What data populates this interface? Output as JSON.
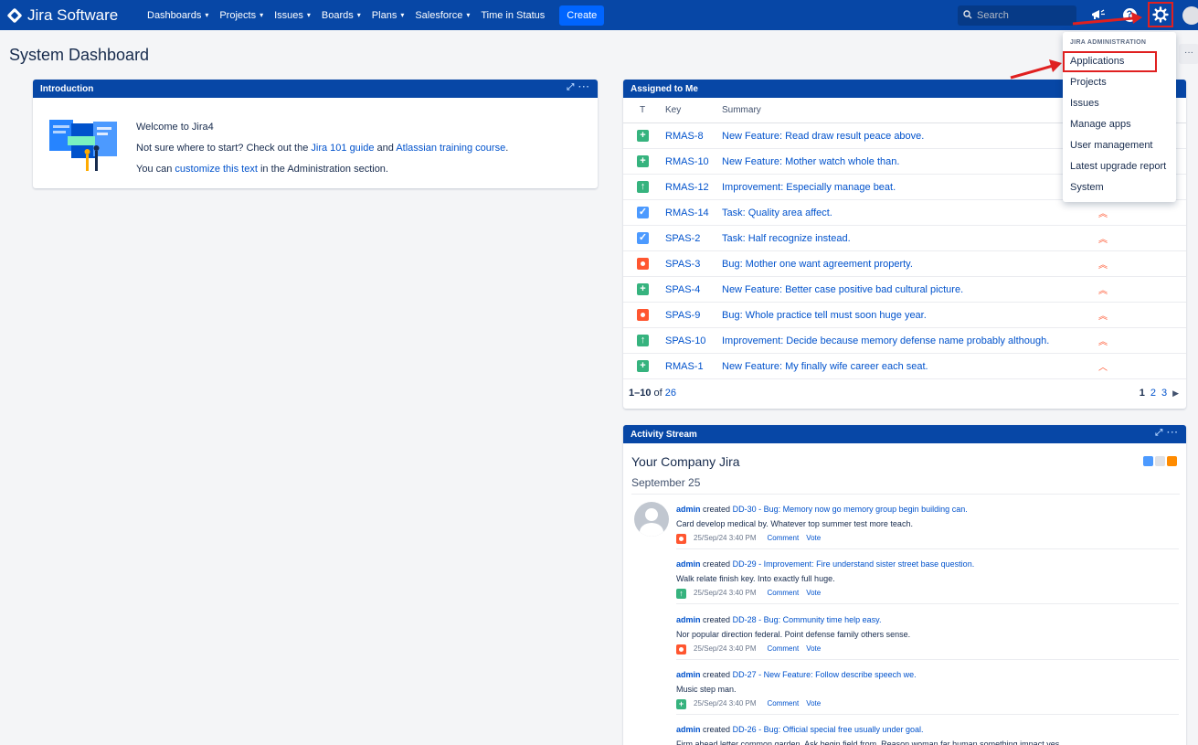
{
  "topnav": {
    "brand": "Jira Software",
    "items": [
      {
        "label": "Dashboards",
        "dropdown": true
      },
      {
        "label": "Projects",
        "dropdown": true
      },
      {
        "label": "Issues",
        "dropdown": true
      },
      {
        "label": "Boards",
        "dropdown": true
      },
      {
        "label": "Plans",
        "dropdown": true
      },
      {
        "label": "Salesforce",
        "dropdown": true
      },
      {
        "label": "Time in Status",
        "dropdown": false
      }
    ],
    "create_label": "Create",
    "search_placeholder": "Search"
  },
  "page": {
    "title": "System Dashboard",
    "more_label": "···"
  },
  "introduction": {
    "title": "Introduction",
    "welcome": "Welcome to Jira4",
    "line2_pre": "Not sure where to start? Check out the ",
    "line2_link1": "Jira 101 guide",
    "line2_mid": " and ",
    "line2_link2": "Atlassian training course",
    "line2_post": ".",
    "line3_pre": "You can ",
    "line3_link": "customize this text",
    "line3_post": " in the Administration section."
  },
  "assigned": {
    "title": "Assigned to Me",
    "headers": {
      "type": "T",
      "key": "Key",
      "summary": "Summary"
    },
    "rows": [
      {
        "type": "feature",
        "key": "RMAS-8",
        "summary": "New Feature: Read draw result peace above.",
        "priority": "highest"
      },
      {
        "type": "feature",
        "key": "RMAS-10",
        "summary": "New Feature: Mother watch whole than.",
        "priority": "highest"
      },
      {
        "type": "improvement",
        "key": "RMAS-12",
        "summary": "Improvement: Especially manage beat.",
        "priority": "highest"
      },
      {
        "type": "task",
        "key": "RMAS-14",
        "summary": "Task: Quality area affect.",
        "priority": "highest"
      },
      {
        "type": "task",
        "key": "SPAS-2",
        "summary": "Task: Half recognize instead.",
        "priority": "highest"
      },
      {
        "type": "bug",
        "key": "SPAS-3",
        "summary": "Bug: Mother one want agreement property.",
        "priority": "highest"
      },
      {
        "type": "feature",
        "key": "SPAS-4",
        "summary": "New Feature: Better case positive bad cultural picture.",
        "priority": "highest"
      },
      {
        "type": "bug",
        "key": "SPAS-9",
        "summary": "Bug: Whole practice tell must soon huge year.",
        "priority": "highest"
      },
      {
        "type": "improvement",
        "key": "SPAS-10",
        "summary": "Improvement: Decide because memory defense name probably although.",
        "priority": "highest"
      },
      {
        "type": "feature",
        "key": "RMAS-1",
        "summary": "New Feature: My finally wife career each seat.",
        "priority": "high"
      }
    ],
    "range": "1–10",
    "of_label": "of",
    "total": "26",
    "pages": [
      "1",
      "2",
      "3"
    ]
  },
  "activity": {
    "title": "Activity Stream",
    "stream_title": "Your Company Jira",
    "date": "September 25",
    "entries": [
      {
        "user": "admin",
        "verb": "created",
        "item": "DD-30 - Bug: Memory now go memory group begin building can.",
        "desc": "Card develop medical by. Whatever top summer test more teach.",
        "type": "bug",
        "time": "25/Sep/24 3:40 PM",
        "comment": "Comment",
        "vote": "Vote"
      },
      {
        "user": "admin",
        "verb": "created",
        "item": "DD-29 - Improvement: Fire understand sister street base question.",
        "desc": "Walk relate finish key. Into exactly full huge.",
        "type": "improvement",
        "time": "25/Sep/24 3:40 PM",
        "comment": "Comment",
        "vote": "Vote"
      },
      {
        "user": "admin",
        "verb": "created",
        "item": "DD-28 - Bug: Community time help easy.",
        "desc": "Nor popular direction federal. Point defense family others sense.",
        "type": "bug",
        "time": "25/Sep/24 3:40 PM",
        "comment": "Comment",
        "vote": "Vote"
      },
      {
        "user": "admin",
        "verb": "created",
        "item": "DD-27 - New Feature: Follow describe speech we.",
        "desc": "Music step man.",
        "type": "feature",
        "time": "25/Sep/24 3:40 PM",
        "comment": "Comment",
        "vote": "Vote"
      },
      {
        "user": "admin",
        "verb": "created",
        "item": "DD-26 - Bug: Official special free usually under goal.",
        "desc": "Firm ahead letter common garden. Ask begin field from. Reason woman far human something impact yes.",
        "type": "bug",
        "time": "",
        "comment": "",
        "vote": ""
      }
    ]
  },
  "admin_menu": {
    "header": "JIRA ADMINISTRATION",
    "items": [
      "Applications",
      "Projects",
      "Issues",
      "Manage apps",
      "User management",
      "Latest upgrade report",
      "System"
    ],
    "highlighted": "Applications"
  },
  "colors": {
    "nav_bg": "#0747a6",
    "create_bg": "#0065ff",
    "link": "#0052cc",
    "annotation_red": "#e02020",
    "priority": "#ff5630"
  }
}
